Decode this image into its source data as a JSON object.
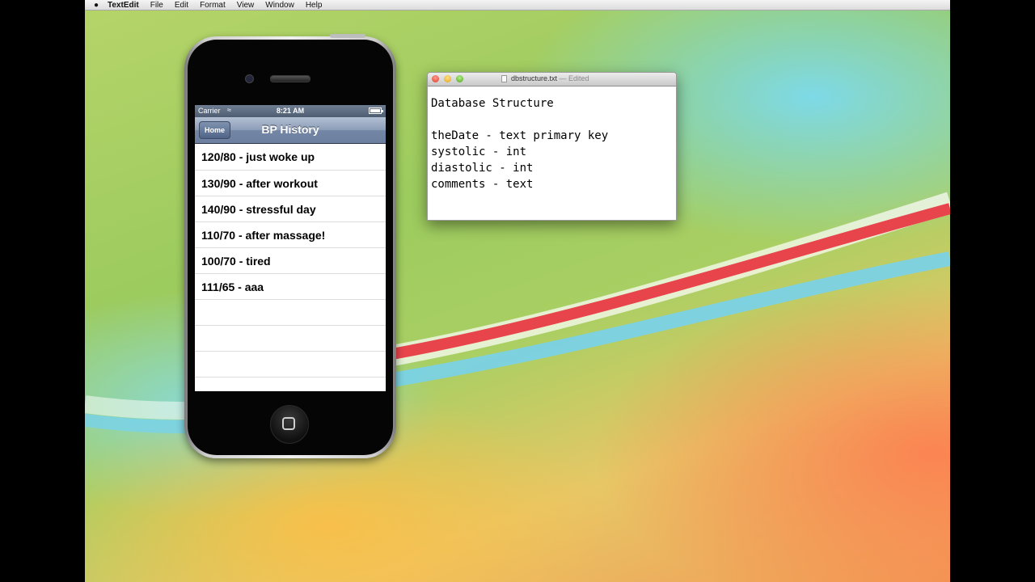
{
  "menubar": {
    "app": "TextEdit",
    "items": [
      "File",
      "Edit",
      "Format",
      "View",
      "Window",
      "Help"
    ]
  },
  "iphone": {
    "status": {
      "carrier": "Carrier",
      "time": "8:21 AM"
    },
    "nav": {
      "back": "Home",
      "title": "BP History"
    },
    "rows": [
      "120/80 - just woke up",
      "130/90 - after workout",
      "140/90 - stressful day",
      "110/70 - after massage!",
      "100/70 - tired",
      "111/65 - aaa"
    ]
  },
  "textedit": {
    "filename": "dbstructure.txt",
    "edited": " — Edited",
    "lines": [
      "Database Structure",
      "",
      "theDate - text primary key",
      "systolic - int",
      "diastolic - int",
      "comments - text"
    ]
  },
  "icons": [
    "apple-icon",
    "wifi-icon",
    "battery-icon",
    "document-icon",
    "home-button-icon",
    "mouse-cursor-icon"
  ]
}
